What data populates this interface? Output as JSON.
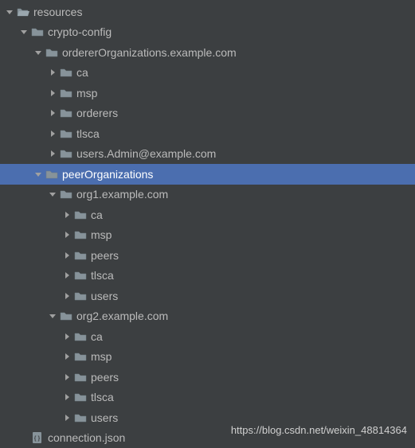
{
  "watermark": "https://blog.csdn.net/weixin_48814364",
  "tree": [
    {
      "depth": 0,
      "arrow": "down",
      "icon": "folder-open",
      "label": "resources",
      "selected": false
    },
    {
      "depth": 1,
      "arrow": "down",
      "icon": "folder",
      "label": "crypto-config",
      "selected": false
    },
    {
      "depth": 2,
      "arrow": "down",
      "icon": "folder",
      "label": "ordererOrganizations.example.com",
      "selected": false
    },
    {
      "depth": 3,
      "arrow": "right",
      "icon": "folder",
      "label": "ca",
      "selected": false
    },
    {
      "depth": 3,
      "arrow": "right",
      "icon": "folder",
      "label": "msp",
      "selected": false
    },
    {
      "depth": 3,
      "arrow": "right",
      "icon": "folder",
      "label": "orderers",
      "selected": false
    },
    {
      "depth": 3,
      "arrow": "right",
      "icon": "folder",
      "label": "tlsca",
      "selected": false
    },
    {
      "depth": 3,
      "arrow": "right",
      "icon": "folder",
      "label": "users.Admin@example.com",
      "selected": false
    },
    {
      "depth": 2,
      "arrow": "down",
      "icon": "folder",
      "label": "peerOrganizations",
      "selected": true
    },
    {
      "depth": 3,
      "arrow": "down",
      "icon": "folder",
      "label": "org1.example.com",
      "selected": false
    },
    {
      "depth": 4,
      "arrow": "right",
      "icon": "folder",
      "label": "ca",
      "selected": false
    },
    {
      "depth": 4,
      "arrow": "right",
      "icon": "folder",
      "label": "msp",
      "selected": false
    },
    {
      "depth": 4,
      "arrow": "right",
      "icon": "folder",
      "label": "peers",
      "selected": false
    },
    {
      "depth": 4,
      "arrow": "right",
      "icon": "folder",
      "label": "tlsca",
      "selected": false
    },
    {
      "depth": 4,
      "arrow": "right",
      "icon": "folder",
      "label": "users",
      "selected": false
    },
    {
      "depth": 3,
      "arrow": "down",
      "icon": "folder",
      "label": "org2.example.com",
      "selected": false
    },
    {
      "depth": 4,
      "arrow": "right",
      "icon": "folder",
      "label": "ca",
      "selected": false
    },
    {
      "depth": 4,
      "arrow": "right",
      "icon": "folder",
      "label": "msp",
      "selected": false
    },
    {
      "depth": 4,
      "arrow": "right",
      "icon": "folder",
      "label": "peers",
      "selected": false
    },
    {
      "depth": 4,
      "arrow": "right",
      "icon": "folder",
      "label": "tlsca",
      "selected": false
    },
    {
      "depth": 4,
      "arrow": "right",
      "icon": "folder",
      "label": "users",
      "selected": false
    },
    {
      "depth": 1,
      "arrow": "none",
      "icon": "json",
      "label": "connection.json",
      "selected": false
    }
  ]
}
